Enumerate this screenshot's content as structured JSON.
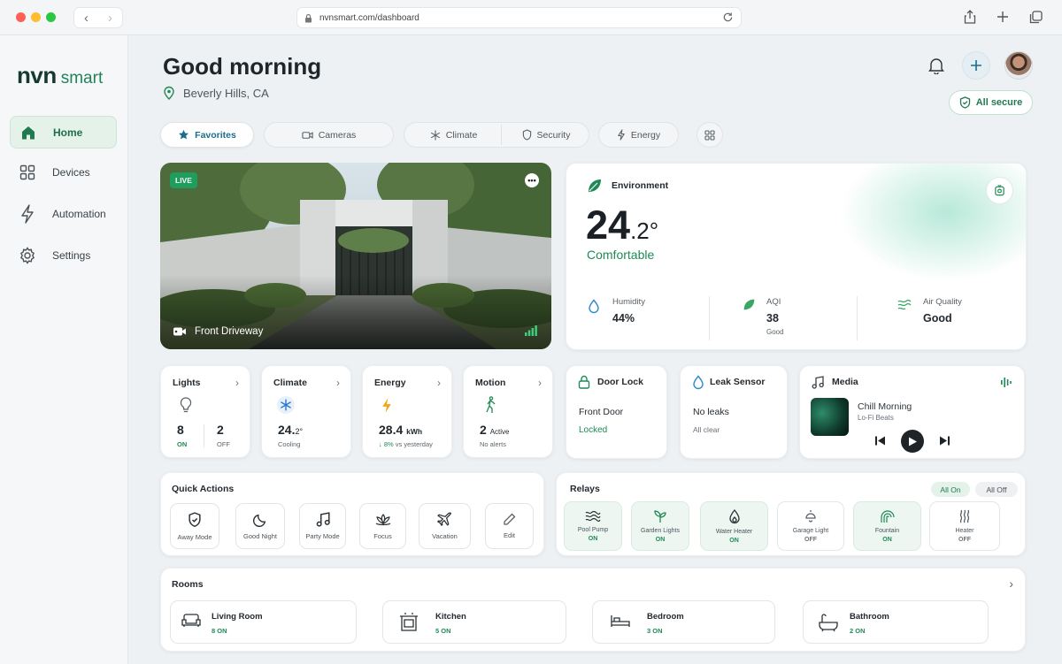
{
  "browser": {
    "url": "nvnsmart.com/dashboard"
  },
  "brand": {
    "name": "nvn",
    "suffix": "smart"
  },
  "sidebar": {
    "items": [
      {
        "label": "Home",
        "icon": "home-icon",
        "active": true
      },
      {
        "label": "Devices",
        "icon": "grid-icon"
      },
      {
        "label": "Automation",
        "icon": "bolt-icon"
      },
      {
        "label": "Settings",
        "icon": "gear-icon"
      }
    ]
  },
  "header": {
    "greeting": "Good morning",
    "location": "Beverly Hills, CA",
    "secure_label": "All secure"
  },
  "tabs": [
    {
      "label": "Favorites",
      "icon": "star-icon",
      "active": true
    },
    {
      "label": "Cameras",
      "icon": "camera-icon"
    },
    {
      "label": "Climate",
      "icon": "snowflake-icon"
    },
    {
      "label": "Security",
      "icon": "shield-icon"
    },
    {
      "label": "Energy",
      "icon": "bolt-icon"
    }
  ],
  "camera": {
    "badge": "LIVE",
    "name": "Front Driveway"
  },
  "environment": {
    "title": "Environment",
    "temp_int": "24",
    "temp_dec": ".2°",
    "status": "Comfortable",
    "metrics": [
      {
        "label": "Humidity",
        "value": "44%",
        "sub": ""
      },
      {
        "label": "AQI",
        "value": "38",
        "sub": "Good"
      },
      {
        "label": "Air Quality",
        "value": "Good",
        "sub": ""
      }
    ]
  },
  "stats": {
    "lights": {
      "title": "Lights",
      "on_count": "8",
      "on_label": "ON",
      "off_count": "2",
      "off_label": "OFF"
    },
    "climate": {
      "title": "Climate",
      "value": "24.",
      "decimal": "2°",
      "sub": "Cooling"
    },
    "energy": {
      "title": "Energy",
      "value": "28.4",
      "unit": "kWh",
      "sub": "↓ 8%",
      "sub2": "vs yesterday"
    },
    "motion": {
      "title": "Motion",
      "value": "2",
      "unit": "Active",
      "sub": "No alerts"
    }
  },
  "door_lock": {
    "title": "Door Lock",
    "location": "Front Door",
    "status": "Locked"
  },
  "leak": {
    "title": "Leak Sensor",
    "status": "No leaks",
    "sub": "All clear"
  },
  "media": {
    "title": "Media",
    "track": "Chill Morning",
    "artist": "Lo-Fi Beats"
  },
  "quick_actions": {
    "title": "Quick Actions",
    "items": [
      {
        "label": "Away Mode",
        "icon": "shield-check-icon"
      },
      {
        "label": "Good Night",
        "icon": "moon-icon"
      },
      {
        "label": "Party Mode",
        "icon": "music-note-icon"
      },
      {
        "label": "Focus",
        "icon": "lotus-icon"
      },
      {
        "label": "Vacation",
        "icon": "plane-icon"
      },
      {
        "label": "Edit",
        "icon": "pencil-icon"
      }
    ]
  },
  "relays": {
    "title": "Relays",
    "all_on": "All On",
    "all_off": "All Off",
    "items": [
      {
        "label": "Pool Pump",
        "state": "ON",
        "icon": "waves-icon"
      },
      {
        "label": "Garden Lights",
        "state": "ON",
        "icon": "sprout-icon"
      },
      {
        "label": "Water Heater",
        "state": "ON",
        "icon": "flame-icon"
      },
      {
        "label": "Garage Light",
        "state": "OFF",
        "icon": "lamp-icon"
      },
      {
        "label": "Fountain",
        "state": "ON",
        "icon": "fountain-icon"
      },
      {
        "label": "Heater",
        "state": "OFF",
        "icon": "heat-icon"
      }
    ]
  },
  "rooms": {
    "title": "Rooms",
    "items": [
      {
        "name": "Living Room",
        "count": "8 ON",
        "icon": "sofa-icon"
      },
      {
        "name": "Kitchen",
        "count": "5 ON",
        "icon": "stove-icon"
      },
      {
        "name": "Bedroom",
        "count": "3 ON",
        "icon": "bed-icon"
      },
      {
        "name": "Bathroom",
        "count": "2 ON",
        "icon": "bathtub-icon"
      }
    ]
  },
  "colors": {
    "accent": "#1f8a55",
    "brand_dark": "#163a2e",
    "energy": "#f2a516",
    "frost": "#2c79c9"
  }
}
